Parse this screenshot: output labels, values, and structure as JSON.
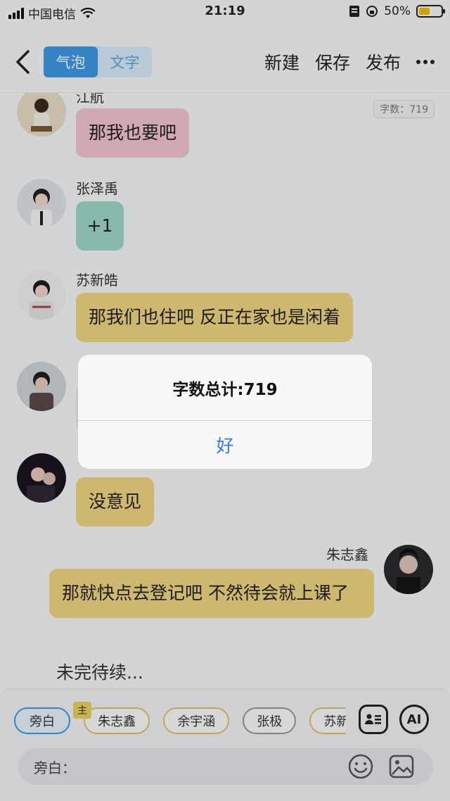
{
  "status_bar": {
    "carrier": "中国电信",
    "time": "21:19",
    "battery": "50%"
  },
  "nav": {
    "tab_bubble": "气泡",
    "tab_text": "文字",
    "new_label": "新建",
    "save_label": "保存",
    "publish_label": "发布",
    "word_count_badge": "字数：719"
  },
  "messages": [
    {
      "name": "江航",
      "text": "那我也要吧",
      "color": "#f4c6cf"
    },
    {
      "name": "张泽禹",
      "text": "+1",
      "color": "#9fd6c9"
    },
    {
      "name": "苏新皓",
      "text": "那我们也住吧 反正在家也是闲着",
      "color": "#f0d680"
    },
    {
      "name": "",
      "text": "",
      "color": "#e8e8e8"
    },
    {
      "name": "",
      "text": "没意见",
      "color": "#f0d680"
    },
    {
      "name": "朱志鑫",
      "text": "那就快点去登记吧 不然待会就上课了",
      "color": "#f0d680"
    }
  ],
  "narration_text": "未完待续...",
  "bottom": {
    "chips": [
      "旁白",
      "朱志鑫",
      "余宇涵",
      "张极",
      "苏新皓"
    ],
    "host_badge": "主",
    "ai_label": "AI",
    "input_placeholder": "旁白："
  },
  "dialog": {
    "title": "字数总计:719",
    "ok_label": "好"
  },
  "icons": [
    "back-icon",
    "more-icon",
    "contact-card-icon",
    "ai-icon",
    "emoji-icon",
    "image-icon",
    "wifi-icon",
    "signal-icon",
    "battery-icon"
  ]
}
